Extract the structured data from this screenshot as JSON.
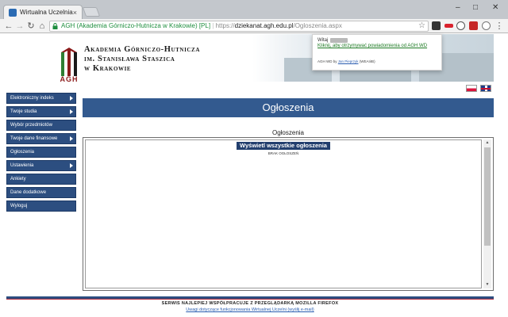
{
  "browser": {
    "tab_title": "Wirtualna Uczelnia",
    "tab_close": "×",
    "window_controls": {
      "minimize": "–",
      "maximize": "□",
      "close": "✕"
    },
    "nav": {
      "back": "←",
      "forward": "→",
      "reload": "↻",
      "home": "⌂"
    },
    "url": {
      "secure_label": "AGH (Akademia Górniczo-Hutnicza w Krakowie) [PL]",
      "scheme": "https://",
      "host": "dziekanat.agh.edu.pl",
      "path": "/Ogloszenia.aspx"
    },
    "bookmark_star": "☆",
    "menu_dots": "⋮"
  },
  "header": {
    "logo_agh": "AGH",
    "logo_lines": [
      "Akademia Górniczo-Hutnicza",
      "im. Stanisława Staszica",
      "w Krakowie"
    ]
  },
  "notification": {
    "hello": "Witaj",
    "link": "Kliknij, aby otrzymywać powiadomienia od AGH WD",
    "footer_prefix": "AGH WD by",
    "author": "Jan Pieprzyk",
    "footer_suffix": "(WEAIiIB)"
  },
  "sidebar": {
    "items": [
      {
        "label": "Elektroniczny indeks",
        "arrow": true
      },
      {
        "label": "Twoje studia",
        "arrow": true
      },
      {
        "label": "Wybór przedmiotów",
        "arrow": false
      },
      {
        "label": "Twoje dane finansowe",
        "arrow": true
      },
      {
        "label": "Ogłoszenia",
        "arrow": false
      },
      {
        "label": "Ustawienia",
        "arrow": true
      },
      {
        "label": "Ankiety",
        "arrow": false
      },
      {
        "label": "Dane dodatkowe",
        "arrow": false
      },
      {
        "label": "Wyloguj",
        "arrow": false
      }
    ]
  },
  "main": {
    "title": "Ogłoszenia",
    "section_label": "Ogłoszenia",
    "show_all_button": "Wyświetl wszystkie ogłoszenia",
    "empty_text": "BRAK OGŁOSZEŃ"
  },
  "footer": {
    "text": "SERWIS NAJLEPIEJ WSPÓŁPRACUJE Z PRZEGLĄDARKĄ MOZILLA FIREFOX",
    "link": "Uwagi dotyczące funkcjonowania Wirtualnej Uczelni (wyślij e-mail)"
  },
  "colors": {
    "menu_bg": "#2c4e80",
    "header_bg": "#335a8f",
    "button_bg": "#233f6e",
    "logo_red": "#8b1a1a",
    "secure_green": "#1e8e3e"
  }
}
